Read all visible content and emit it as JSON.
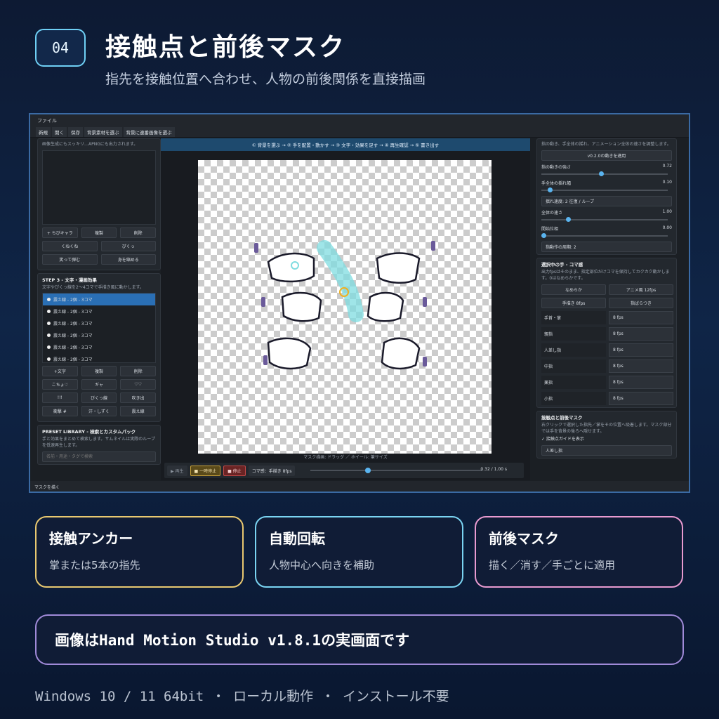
{
  "header": {
    "badge": "04",
    "title": "接触点と前後マスク",
    "subtitle": "指先を接触位置へ合わせ、人物の前後関係を直接描画"
  },
  "app": {
    "menu": "ファイル",
    "toolbar": [
      "新規",
      "開く",
      "保存",
      "背景素材を選ぶ",
      "背景に連番画像を選ぶ"
    ],
    "left": {
      "intro": "画像生成にもスッキリ…APNGにも出力されます。",
      "btns1": [
        "+ ちびキャラ",
        "複製",
        "削除"
      ],
      "btns2": [
        "くねくね",
        "ぴくっ"
      ],
      "btns3": [
        "笑って弾む",
        "身を縮める"
      ],
      "step3_title": "STEP 3 - 文字・漫画効果",
      "step3_desc": "文字やぴくっ線を2〜4コマで手描き風に動かします。",
      "list": [
        "震え線 - 2個 - 3コマ",
        "震え線 - 2個 - 3コマ",
        "震え線 - 2個 - 3コマ",
        "震え線 - 2個 - 3コマ",
        "震え線 - 2個 - 3コマ",
        "震え線 - 2個 - 3コマ"
      ],
      "btns4": [
        "+文字",
        "複製",
        "削除"
      ],
      "btns5": [
        "こちょ♡",
        "ギャ",
        "♡♡"
      ],
      "btns6": [
        "!!!",
        "びくっ線",
        "吹き出"
      ],
      "btns7": [
        "衝撃 #",
        "汗・しずく",
        "震え線"
      ],
      "preset_title": "PRESET LIBRARY - 検索とカスタムパック",
      "preset_desc": "手と効果をまとめて検索します。サムネイルは実際のループを低速再生します。",
      "search_placeholder": "名前・用途・タグで検索"
    },
    "center": {
      "steps": "① 背景を選ぶ → ② 手を配置・動かす → ③ 文字・効果を足す → ④ 再生確認 → ⑤ 書き出す",
      "mask_hint": "マスク描画: ドラッグ ／ ホイール: 筆サイズ",
      "play": "▶ 再生",
      "pause": "■ 一時停止",
      "stop": "■ 停止",
      "fps": "コマ感：手描き 8fps",
      "time": "0.32 / 1.00 s",
      "progress": 0.32
    },
    "right": {
      "top_desc": "指の動き、手全体の揺れ、アニメーション全体の速さを調整します。",
      "apply_btn": "v0.2.0の動きを適用",
      "sliders": [
        {
          "label": "指の動きの強さ",
          "value": "0.72",
          "pos": 0.44
        },
        {
          "label": "手全体の揺れ幅",
          "value": "0.10",
          "pos": 0.05
        },
        {
          "label": "全体の速さ",
          "value": "1.00",
          "pos": 0.19
        },
        {
          "label": "開始位相",
          "value": "0.00",
          "pos": 0.0
        }
      ],
      "sway": "揺れ速度: 2 往復 / ループ",
      "cycle": "指動作の周期: 2",
      "sel_title": "選択中の手 - コマ感",
      "sel_desc": "出力fpsはそのまま、指定部位だけコマを保持してカクカク動かします。0はなめらかです。",
      "quick": [
        "なめらか",
        "アニメ風 12fps",
        "手描き 8fps",
        "指ばらつき"
      ],
      "parts": [
        [
          "手首・掌",
          "8 fps"
        ],
        [
          "親指",
          "8 fps"
        ],
        [
          "人差し指",
          "8 fps"
        ],
        [
          "中指",
          "8 fps"
        ],
        [
          "薬指",
          "8 fps"
        ],
        [
          "小指",
          "8 fps"
        ]
      ],
      "contact_title": "接触点と前後マスク",
      "contact_desc": "右クリックで選択した指先／掌をその位置へ吸着します。マスク部分では手を背景の後ろへ隠せます。",
      "guide": "✓ 接触点ガイドを表示",
      "finger": "人差し指"
    },
    "status": "マスクを描く"
  },
  "cards": [
    {
      "title": "接触アンカー",
      "desc": "掌または5本の指先",
      "color": "#e8c870"
    },
    {
      "title": "自動回転",
      "desc": "人物中心へ向きを補助",
      "color": "#7ad4f2"
    },
    {
      "title": "前後マスク",
      "desc": "描く／消す／手ごとに適用",
      "color": "#e89ad0"
    }
  ],
  "banner": "画像はHand Motion Studio v1.8.1の実画面です",
  "footer": "Windows 10 / 11 64bit ・ ローカル動作 ・ インストール不要"
}
